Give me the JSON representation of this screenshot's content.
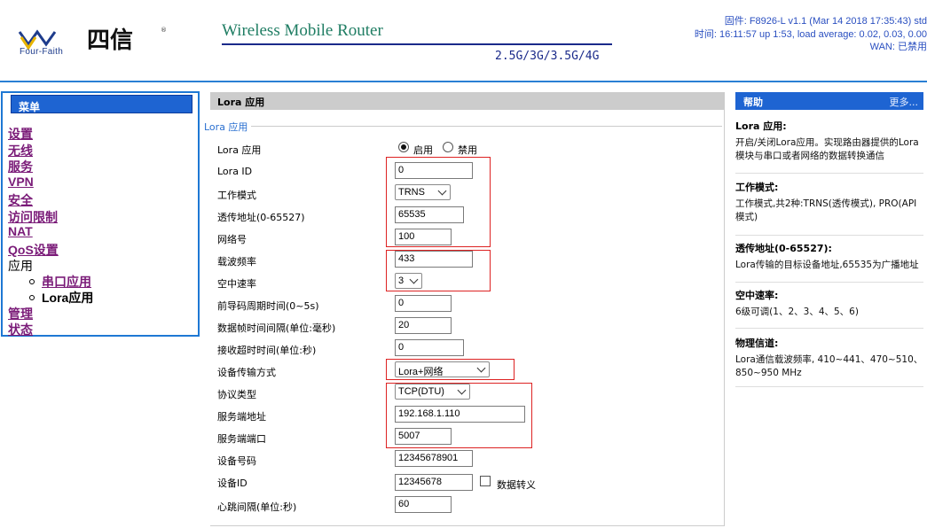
{
  "header": {
    "brand_sub": "Four-Faith",
    "title": "Wireless Mobile Router",
    "subtitle": "2.5G/3G/3.5G/4G",
    "firmware": "固件: F8926-L v1.1 (Mar 14 2018 17:35:43) std",
    "time": "时间: 16:11:57 up 1:53, load average: 0.02, 0.03, 0.00",
    "wan": "WAN: 已禁用"
  },
  "menu": {
    "title": "菜单",
    "items": [
      "设置",
      "无线",
      "服务",
      "VPN",
      "安全",
      "访问限制",
      "NAT",
      "QoS设置",
      "应用"
    ],
    "app_sub": [
      "串口应用",
      "Lora应用"
    ],
    "tail": [
      "管理",
      "状态"
    ]
  },
  "main": {
    "header": "Lora 应用",
    "legend": "Lora 应用",
    "enable_label": "Lora 应用",
    "radio_on": "启用",
    "radio_off": "禁用",
    "rows": [
      {
        "label": "Lora ID",
        "value": "0"
      },
      {
        "label": "工作模式",
        "value": "TRNS"
      },
      {
        "label": "透传地址(0-65527)",
        "value": "65535"
      },
      {
        "label": "网络号",
        "value": "100"
      },
      {
        "label": "载波频率",
        "value": "433"
      },
      {
        "label": "空中速率",
        "value": "3"
      },
      {
        "label": "前导码周期时间(0~5s)",
        "value": "0"
      },
      {
        "label": "数据帧时间间隔(单位:毫秒)",
        "value": "20"
      },
      {
        "label": "接收超时时间(单位:秒)",
        "value": "0"
      },
      {
        "label": "设备传输方式",
        "value": "Lora+网络"
      },
      {
        "label": "协议类型",
        "value": "TCP(DTU)"
      },
      {
        "label": "服务端地址",
        "value": "192.168.1.110"
      },
      {
        "label": "服务端端口",
        "value": "5007"
      },
      {
        "label": "设备号码",
        "value": "12345678901"
      },
      {
        "label": "设备ID",
        "value": "12345678"
      },
      {
        "label": "心跳间隔(单位:秒)",
        "value": "60"
      }
    ],
    "escape_label": "数据转义"
  },
  "help": {
    "title": "帮助",
    "more": "更多...",
    "sections": [
      {
        "title": "Lora 应用:",
        "body": "开启/关闭Lora应用。实现路由器提供的Lora模块与串口或者网络的数据转换通信"
      },
      {
        "title": "工作模式:",
        "body": "工作模式,共2种:TRNS(透传模式), PRO(API模式)"
      },
      {
        "title": "透传地址(0-65527):",
        "body": "Lora传输的目标设备地址,65535为广播地址"
      },
      {
        "title": "空中速率:",
        "body": "6级可调(1、2、3、4、5、6)"
      },
      {
        "title": "物理信道:",
        "body": "Lora通信载波频率, 410~441、470~510、850~950 MHz"
      }
    ]
  },
  "colors": {
    "accent": "#1e64d2",
    "link": "#7a1b78",
    "teal_title": "#1f7d63",
    "highlight_box": "#dd2222"
  }
}
